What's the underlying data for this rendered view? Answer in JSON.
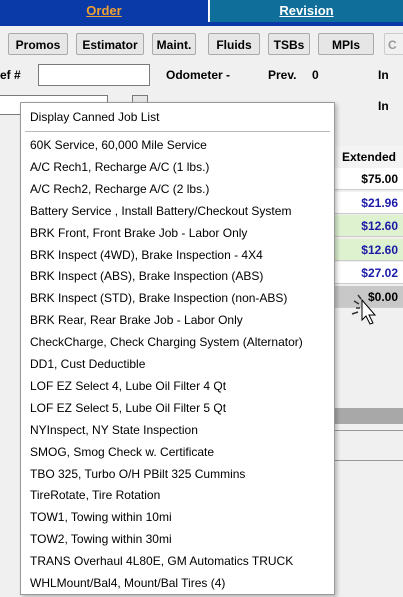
{
  "tabs": {
    "order": "Order",
    "revision": "Revision"
  },
  "toolbar": {
    "promos": "Promos",
    "estimator": "Estimator",
    "maint": "Maint.",
    "fluids": "Fluids",
    "tsbs": "TSBs",
    "mpis": "MPIs",
    "partial": "C"
  },
  "form": {
    "ref_label": "ef #",
    "odometer_label": "Odometer -",
    "prev_label": "Prev.",
    "prev_value": "0",
    "in_label_1": "In",
    "in_label_2": "In"
  },
  "table": {
    "header": "Extended",
    "rows": [
      {
        "value": "$75.00",
        "color": "#000000",
        "bg": "#ffffff"
      },
      {
        "value": "$21.96",
        "color": "#1a1aa8",
        "bg": "#ffffff"
      },
      {
        "value": "$12.60",
        "color": "#1a1aa8",
        "bg": "#dff2d0"
      },
      {
        "value": "$12.60",
        "color": "#1a1aa8",
        "bg": "#dff2d0"
      },
      {
        "value": "$27.02",
        "color": "#1a1aa8",
        "bg": "#ffffff"
      },
      {
        "value": "$0.00",
        "color": "#000000",
        "bg": "#c8c8c8"
      }
    ]
  },
  "dropdown": {
    "header": "Display Canned Job List",
    "items": [
      "60K Service, 60,000 Mile Service",
      "A/C Rech1, Recharge A/C (1 lbs.)",
      "A/C Rech2, Recharge A/C (2 lbs.)",
      "Battery Service , Install Battery/Checkout System",
      "BRK Front, Front Brake Job - Labor Only",
      "BRK Inspect (4WD), Brake Inspection - 4X4",
      "BRK Inspect (ABS), Brake Inspection (ABS)",
      "BRK Inspect (STD), Brake Inspection (non-ABS)",
      "BRK Rear, Rear Brake Job - Labor Only",
      "CheckCharge, Check Charging System (Alternator)",
      "DD1, Cust Deductible",
      "LOF EZ Select 4, Lube Oil Filter 4 Qt",
      "LOF EZ Select 5, Lube Oil Filter 5 Qt",
      "NYInspect, NY State Inspection",
      "SMOG, Smog Check w. Certificate",
      "TBO 325, Turbo O/H PBilt 325 Cummins",
      "TireRotate, Tire Rotation",
      "TOW1, Towing within 10mi",
      "TOW2, Towing within 30mi",
      "TRANS Overhaul 4L80E, GM Automatics TRUCK",
      "WHLMount/Bal4, Mount/Bal Tires (4)"
    ]
  }
}
